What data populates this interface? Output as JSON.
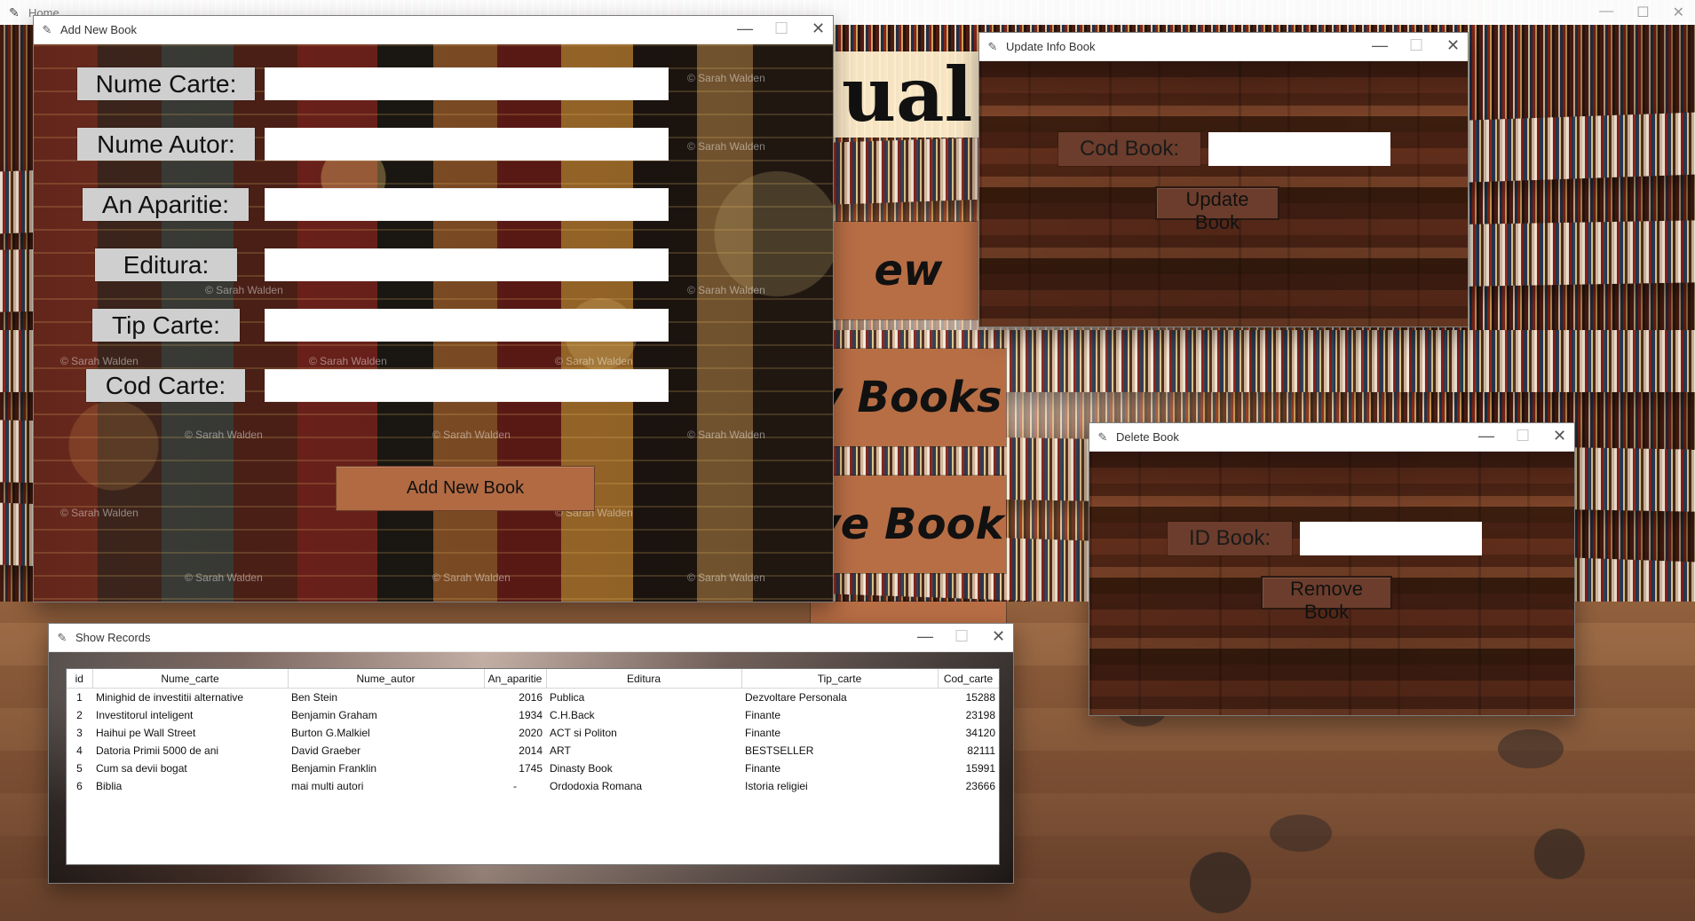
{
  "desktop": {
    "home_title": "Home",
    "brand": "ual L",
    "menu": [
      {
        "label": "ew Book"
      },
      {
        "label": "v Books"
      },
      {
        "label": "ve Book"
      },
      {
        "label": ""
      }
    ]
  },
  "watermark": "© Sarah Walden",
  "windows": {
    "add_book": {
      "title": "Add New Book",
      "labels": [
        "Nume Carte:",
        "Nume Autor:",
        "An Aparitie:",
        "Editura:",
        "Tip Carte:",
        "Cod Carte:"
      ],
      "button": "Add New Book"
    },
    "update_book": {
      "title": "Update Info Book",
      "label": "Cod Book:",
      "button": "Update Book"
    },
    "delete_book": {
      "title": "Delete Book",
      "label": "ID Book:",
      "button": "Remove Book"
    },
    "records": {
      "title": "Show Records",
      "columns": [
        "id",
        "Nume_carte",
        "Nume_autor",
        "An_aparitie",
        "Editura",
        "Tip_carte",
        "Cod_carte"
      ],
      "rows": [
        [
          "1",
          "Minighid de investitii alternative",
          "Ben Stein",
          "2016",
          "Publica",
          "Dezvoltare Personala",
          "15288"
        ],
        [
          "2",
          "Investitorul inteligent",
          "Benjamin Graham",
          "1934",
          "C.H.Back",
          "Finante",
          "23198"
        ],
        [
          "3",
          "Haihui pe Wall Street",
          "Burton G.Malkiel",
          "2020",
          "ACT si Politon",
          "Finante",
          "34120"
        ],
        [
          "4",
          "Datoria Primii 5000 de ani",
          "David Graeber",
          "2014",
          "ART",
          "BESTSELLER",
          "82111"
        ],
        [
          "5",
          "Cum sa devii bogat",
          "Benjamin Franklin",
          "1745",
          "Dinasty Book",
          "Finante",
          "15991"
        ],
        [
          "6",
          "Biblia",
          "mai multi autori",
          "-",
          "Ordodoxia Romana",
          "Istoria religiei",
          "23666"
        ]
      ]
    }
  }
}
